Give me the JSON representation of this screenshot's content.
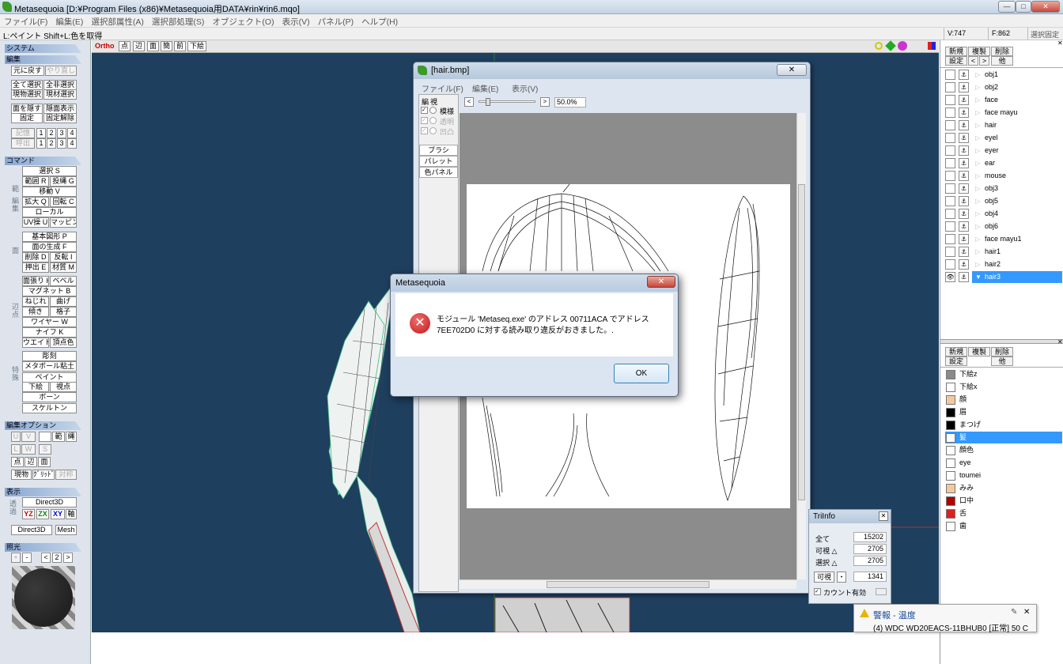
{
  "window": {
    "title": "Metasequoia [D:¥Program Files (x86)¥Metasequoia用DATA¥rin¥rin6.mqo]",
    "min": "—",
    "max": "□",
    "close": "✕"
  },
  "menu": [
    "ファイル(F)",
    "編集(E)",
    "選択部属性(A)",
    "選択部処理(S)",
    "オブジェクト(O)",
    "表示(V)",
    "パネル(P)",
    "ヘルプ(H)"
  ],
  "status": {
    "hint": "L:ペイント  Shift+L:色を取得",
    "vertices": "V:747",
    "faces": "F:862",
    "lock": "選択固定"
  },
  "left": {
    "system": "システム",
    "edit": "編集",
    "undo": "元に戻す",
    "redo": "やり直し",
    "select_all": "全て選択",
    "deselect_all": "全非選択",
    "select_current": "現物選択",
    "select_material": "現材選択",
    "hide_face": "面を隠す",
    "show_hidden": "隠面表示",
    "fix": "固定",
    "unfix": "固定解除",
    "memory": "記憶",
    "recall": "呼出",
    "n1": "1",
    "n2": "2",
    "n3": "3",
    "n4": "4",
    "command": "コマンド",
    "basic_label": "範",
    "edit_label": "編集",
    "select": "選択 S",
    "range": "範囲 R",
    "lasso": "投縄 G",
    "move": "移動 V",
    "scale": "拡大 Q",
    "rotate": "回転 C",
    "local": "ローカル",
    "uv": "UV操 U",
    "mapping": "マッピング",
    "create_label": "面",
    "basic_shape": "基本図形 P",
    "face_gen": "面の生成 F",
    "delete": "削除 D",
    "invert": "反転 I",
    "extrude": "押出 E",
    "material_m": "材質 M",
    "edge_label": "辺・点",
    "knife_h": "面張り H",
    "bevel": "ベベル",
    "magnet": "マグネット B",
    "twist": "ねじれ",
    "bend": "曲げ",
    "tilt": "傾き",
    "lattice": "格子",
    "wire": "ワイヤー W",
    "knife": "ナイフ K",
    "weight": "ウエイト",
    "vertex_color": "頂点色",
    "special_label": "特殊",
    "carve": "彫刻",
    "metaball": "メタボール粘土",
    "paint": "ペイント",
    "underlay": "下絵",
    "viewpoint": "視点",
    "bone": "ボーン",
    "skeleton": "スケルトン",
    "edit_option": "編集オプション",
    "u": "U",
    "v": "V",
    "range_opt": "範",
    "link": "縄",
    "l": "L",
    "w": "W",
    "s": "S",
    "point": "点",
    "edge": "辺",
    "face": "面",
    "current_obj": "現物",
    "grid": "ｸﾞﾘｯﾄﾞ",
    "symmetry": "対称",
    "display": "表示",
    "direct3d": "Direct3D",
    "yz": "YZ",
    "zx": "ZX",
    "xy": "XY",
    "axis": "軸",
    "direct3d2": "Direct3D",
    "mesh": "Mesh",
    "transparent": "透過",
    "lighting": "照光",
    "plus": "+",
    "minus": "-",
    "lt": "<",
    "light_n": "2",
    "gt": ">"
  },
  "viewport_toolbar": {
    "ortho": "Ortho",
    "point": "点",
    "edge": "辺",
    "face": "面",
    "wire": "簡",
    "front": "前",
    "underlay": "下絵"
  },
  "hairwin": {
    "title": "[hair.bmp]",
    "menu": [
      "ファイル(F)",
      "編集(E)",
      "表示(V)"
    ],
    "edit": "編",
    "view": "視",
    "pattern": "模様",
    "transparent": "透明",
    "ink": "凹凸",
    "zoom": "50.0%",
    "tabs": [
      "ブラシ",
      "パレット",
      "色パネル"
    ]
  },
  "dialog": {
    "title": "Metasequoia",
    "line1": "モジュール 'Metaseq.exe' のアドレス 00711ACA でアドレス",
    "line2": "7EE702D0 に対する読み取り違反がおきました。.",
    "ok": "OK"
  },
  "right": {
    "new": "新規",
    "dup": "複製",
    "del": "削除",
    "settings": "設定",
    "prev": "<",
    "next": ">",
    "etc": "他",
    "objects": [
      "obj1",
      "obj2",
      "face",
      "face mayu",
      "hair",
      "eyel",
      "eyer",
      "ear",
      "mouse",
      "obj3",
      "obj5",
      "obj4",
      "obj6",
      "face mayu1",
      "hair1",
      "hair2",
      "hair3"
    ],
    "selected_object": "hair3",
    "new2": "新規",
    "dup2": "複製",
    "del2": "削除",
    "settings2": "設定",
    "etc2": "他",
    "materials": [
      {
        "name": "下絵z",
        "color": "#8a8a8a"
      },
      {
        "name": "下絵x",
        "color": "#ffffff"
      },
      {
        "name": "顔",
        "color": "#f2c8a0"
      },
      {
        "name": "眉",
        "color": "#000000"
      },
      {
        "name": "まつげ",
        "color": "#000000"
      },
      {
        "name": "髪",
        "color": "#ffffff"
      },
      {
        "name": "顔色",
        "color": "#ffffff"
      },
      {
        "name": "eye",
        "color": "#ffffff"
      },
      {
        "name": "toumei",
        "color": "#ffffff"
      },
      {
        "name": "みみ",
        "color": "#f2c8a0"
      },
      {
        "name": "口中",
        "color": "#b00000"
      },
      {
        "name": "舌",
        "color": "#e02020"
      },
      {
        "name": "歯",
        "color": "#ffffff"
      }
    ],
    "selected_material": "髪"
  },
  "triinfo": {
    "title": "TriInfo",
    "all": "全て",
    "all_v": "15202",
    "visible": "可視 △",
    "visible_v": "2705",
    "selected": "選択 △",
    "selected_v": "2705",
    "visible2": "可視",
    "dot": "・",
    "visible2_v": "1341",
    "count_enable": "カウント有効"
  },
  "notify": {
    "title": "警報 - 温度",
    "body": "(4) WDC WD20EACS-11BHUB0 [正常] 50 C"
  }
}
